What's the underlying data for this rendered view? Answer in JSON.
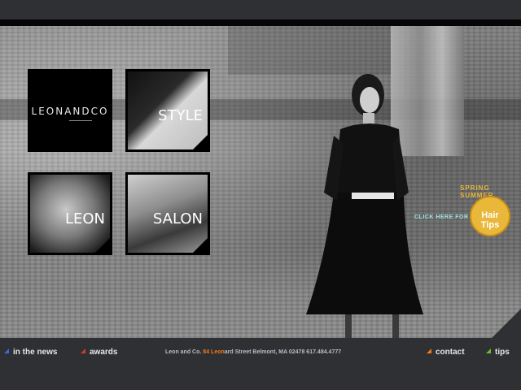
{
  "colors": {
    "blue_mark": "#3a6bd6",
    "red_mark": "#d83a2a",
    "orange_mark": "#f07a1a",
    "green_mark": "#6bbf2a",
    "highlight": "#f07a1a",
    "gold": "#e9b73a"
  },
  "tiles": {
    "logo": "LEONANDCO",
    "style": "STYLE",
    "leon": "LEON",
    "salon": "SALON"
  },
  "promo": {
    "arc": "SPRING SUMMER",
    "click": "CLICK HERE FOR",
    "circle": "Hair Tips"
  },
  "nav": {
    "in_the_news": "in the news",
    "awards": "awards",
    "contact": "contact",
    "tips": "tips"
  },
  "address": {
    "company": "Leon and Co.",
    "num": "84",
    "highlight": "Leon",
    "rest": "ard Street  Belmont, MA 02478",
    "phone": "617.484.4777"
  }
}
